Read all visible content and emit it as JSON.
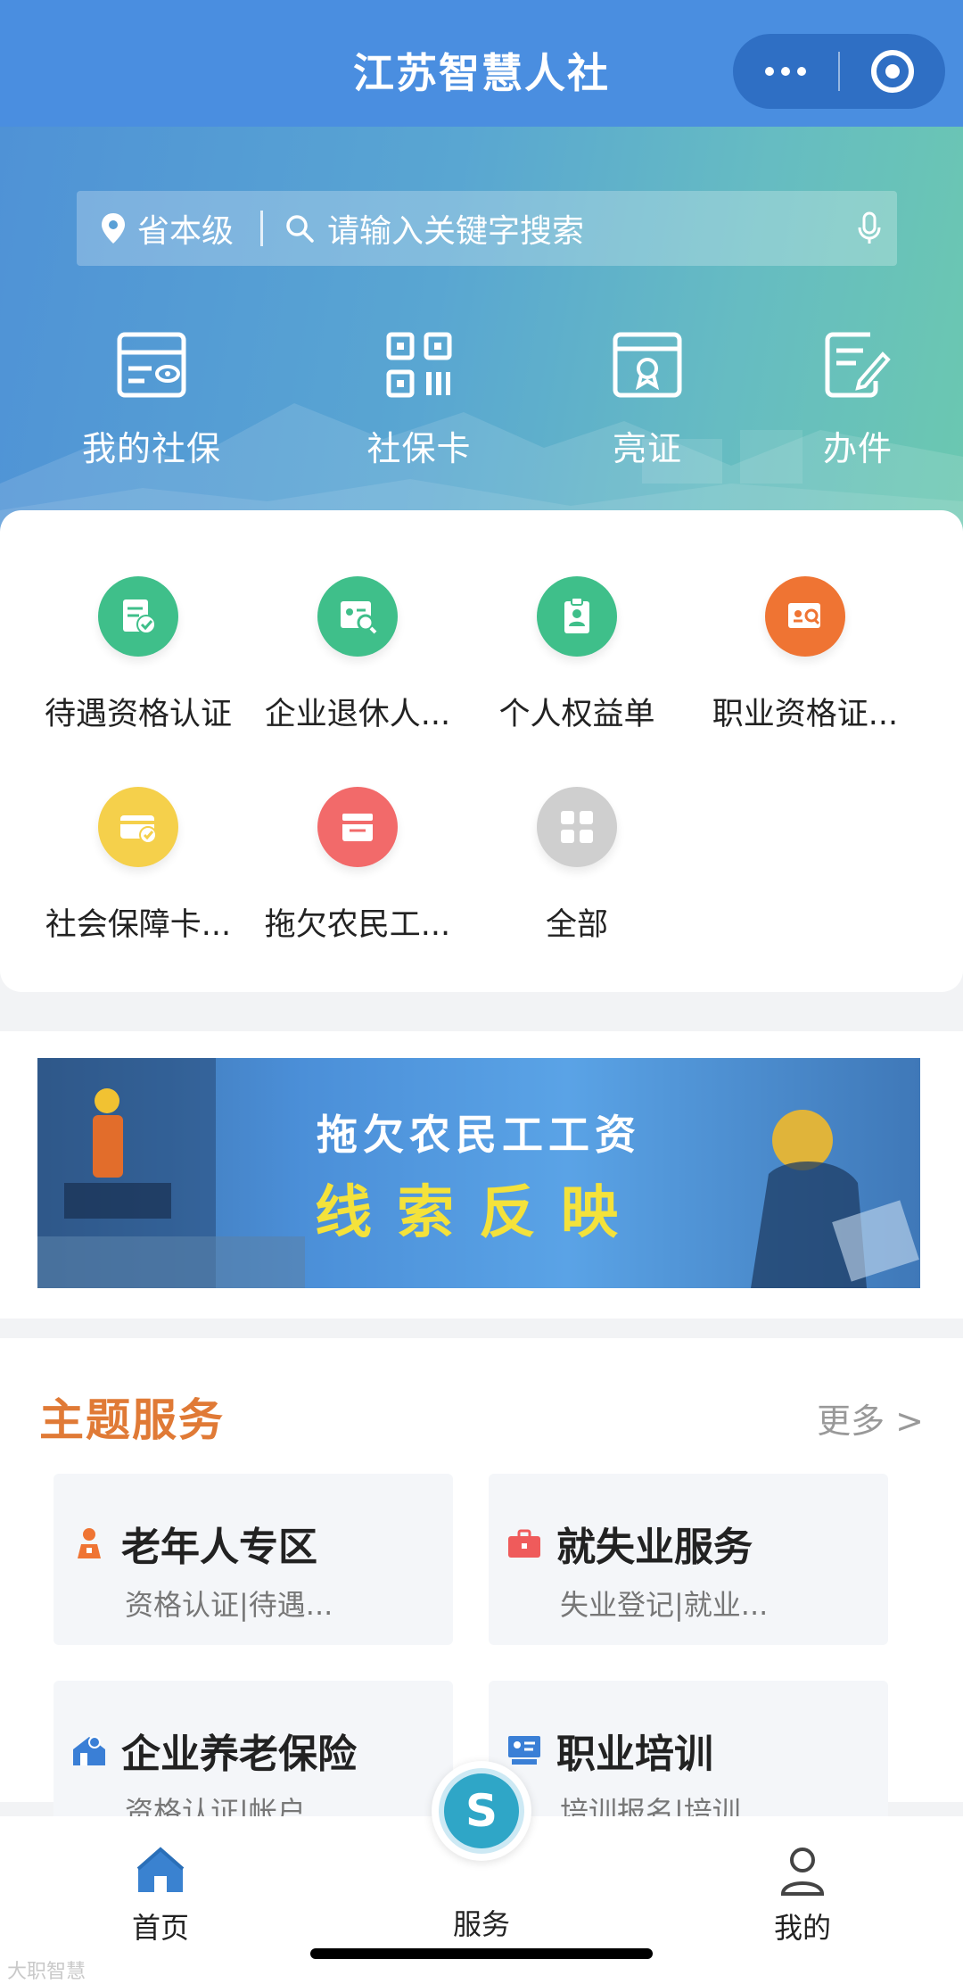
{
  "header": {
    "title": "江苏智慧人社"
  },
  "search": {
    "location": "省本级",
    "placeholder": "请输入关键字搜索"
  },
  "quick_actions": [
    {
      "label": "我的社保",
      "icon": "social-security-card-icon"
    },
    {
      "label": "社保卡",
      "icon": "qr-code-icon"
    },
    {
      "label": "亮证",
      "icon": "certificate-icon"
    },
    {
      "label": "办件",
      "icon": "edit-document-icon"
    }
  ],
  "services": [
    {
      "label": "待遇资格认证",
      "icon": "id-check-icon",
      "color": "#3fbf8a"
    },
    {
      "label": "企业退休人...",
      "icon": "retiree-search-icon",
      "color": "#3fbf8a"
    },
    {
      "label": "个人权益单",
      "icon": "clipboard-person-icon",
      "color": "#3fbf8a"
    },
    {
      "label": "职业资格证...",
      "icon": "certificate-search-icon",
      "color": "#ef7433"
    },
    {
      "label": "社会保障卡...",
      "icon": "card-check-icon",
      "color": "#f5d04b"
    },
    {
      "label": "拖欠农民工...",
      "icon": "tray-icon",
      "color": "#f26a6a"
    },
    {
      "label": "全部",
      "icon": "grid-icon",
      "color": "#cfcfcf"
    }
  ],
  "banner": {
    "line1": "拖欠农民工工资",
    "line2": "线索反映"
  },
  "topic": {
    "title": "主题服务",
    "more": "更多 >",
    "cards": [
      {
        "title": "老年人专区",
        "sub": "资格认证|待遇...",
        "icon": "elderly-icon",
        "color": "#ef7433"
      },
      {
        "title": "就失业服务",
        "sub": "失业登记|就业...",
        "icon": "briefcase-icon",
        "color": "#ef5b5b"
      },
      {
        "title": "企业养老保险",
        "sub": "资格认证|帐户...",
        "icon": "house-person-icon",
        "color": "#3a7fd6"
      },
      {
        "title": "职业培训",
        "sub": "培训报名|培训...",
        "icon": "training-icon",
        "color": "#3a7fd6"
      }
    ]
  },
  "tabbar": {
    "home": "首页",
    "service": "服务",
    "mine": "我的",
    "center_logo": "S"
  },
  "watermark": "大职智慧",
  "colors": {
    "header": "#4a8ee0",
    "accent_orange": "#e07a36",
    "home_blue": "#3a82d0"
  }
}
